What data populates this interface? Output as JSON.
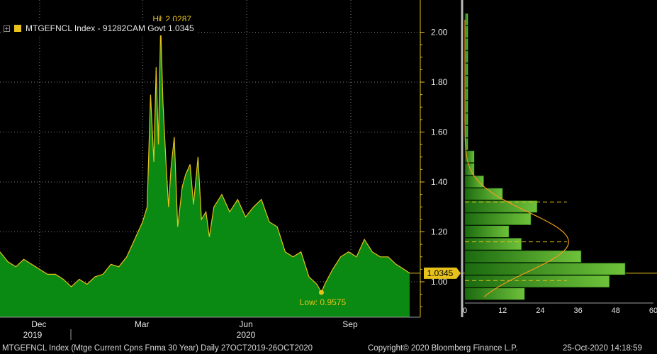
{
  "legend": {
    "text": "MTGEFNCL Index - 91282CAM Govt 1.0345",
    "icon": "expand-square-icon",
    "swatch_color": "#e8c21c"
  },
  "footer": {
    "description": "MTGEFNCL Index (Mtge Current Cpns Fnma 30 Year)  Daily 27OCT2019-26OCT2020",
    "copyright": "Copyright© 2020 Bloomberg Finance L.P.",
    "timestamp": "25-Oct-2020 14:18:59"
  },
  "colors": {
    "background": "#000000",
    "area_fill": "#0a8a12",
    "line": "#e8c21c",
    "grid": "#808080",
    "axis_text": "#e6e6e6"
  },
  "chart_data": [
    {
      "type": "area",
      "title": "",
      "ylim": [
        0.87,
        2.08
      ],
      "yticks": [
        "1.00",
        "1.20",
        "1.40",
        "1.60",
        "1.80",
        "2.00"
      ],
      "x_months": [
        "Dec",
        "Mar",
        "Jun",
        "Sep"
      ],
      "x_years": [
        "2019",
        "2020"
      ],
      "grid": true,
      "x": [
        "2019-10-27",
        "2019-11-03",
        "2019-11-10",
        "2019-11-17",
        "2019-11-24",
        "2019-12-01",
        "2019-12-08",
        "2019-12-15",
        "2019-12-22",
        "2019-12-29",
        "2020-01-05",
        "2020-01-12",
        "2020-01-19",
        "2020-01-26",
        "2020-02-02",
        "2020-02-09",
        "2020-02-16",
        "2020-02-23",
        "2020-03-01",
        "2020-03-05",
        "2020-03-08",
        "2020-03-11",
        "2020-03-13",
        "2020-03-15",
        "2020-03-17",
        "2020-03-19",
        "2020-03-22",
        "2020-03-24",
        "2020-03-26",
        "2020-03-29",
        "2020-04-01",
        "2020-04-05",
        "2020-04-08",
        "2020-04-12",
        "2020-04-15",
        "2020-04-19",
        "2020-04-22",
        "2020-04-26",
        "2020-04-29",
        "2020-05-03",
        "2020-05-10",
        "2020-05-17",
        "2020-05-24",
        "2020-05-31",
        "2020-06-07",
        "2020-06-14",
        "2020-06-21",
        "2020-06-28",
        "2020-07-05",
        "2020-07-12",
        "2020-07-19",
        "2020-07-26",
        "2020-08-02",
        "2020-08-06",
        "2020-08-09",
        "2020-08-16",
        "2020-08-23",
        "2020-08-30",
        "2020-09-06",
        "2020-09-13",
        "2020-09-20",
        "2020-09-27",
        "2020-10-04",
        "2020-10-11",
        "2020-10-18",
        "2020-10-23"
      ],
      "series": [
        {
          "values": [
            1.12,
            1.08,
            1.06,
            1.09,
            1.07,
            1.05,
            1.03,
            1.03,
            1.01,
            0.98,
            1.01,
            0.99,
            1.02,
            1.03,
            1.07,
            1.06,
            1.1,
            1.17,
            1.24,
            1.3,
            1.75,
            1.48,
            1.86,
            1.55,
            2.03,
            1.72,
            1.45,
            1.3,
            1.45,
            1.58,
            1.22,
            1.38,
            1.43,
            1.47,
            1.31,
            1.5,
            1.25,
            1.28,
            1.18,
            1.3,
            1.35,
            1.28,
            1.33,
            1.26,
            1.3,
            1.33,
            1.24,
            1.22,
            1.12,
            1.1,
            1.12,
            1.02,
            0.99,
            0.9575,
            0.99,
            1.05,
            1.1,
            1.12,
            1.1,
            1.17,
            1.12,
            1.1,
            1.1,
            1.07,
            1.05,
            1.0345
          ]
        }
      ],
      "annotations": {
        "high": "Hi: 2.0287",
        "low": "Low: 0.9575",
        "last": "1.0345"
      }
    },
    {
      "type": "bar",
      "orientation": "horizontal",
      "xlim": [
        0,
        60
      ],
      "xticks": [
        "0",
        "12",
        "24",
        "36",
        "48",
        "60"
      ],
      "bins": [
        2.05,
        2.0,
        1.95,
        1.9,
        1.85,
        1.8,
        1.75,
        1.7,
        1.65,
        1.6,
        1.55,
        1.5,
        1.45,
        1.4,
        1.35,
        1.3,
        1.25,
        1.2,
        1.15,
        1.1,
        1.05,
        1.0,
        0.95
      ],
      "values": [
        1,
        1,
        1,
        1,
        1,
        1,
        1,
        1,
        1,
        1,
        1,
        3,
        3,
        6,
        12,
        23,
        21,
        14,
        18,
        37,
        51,
        46,
        19
      ],
      "dashed_levels": [
        1.32,
        1.16,
        1.005
      ],
      "fitted_curve": "normal"
    }
  ]
}
